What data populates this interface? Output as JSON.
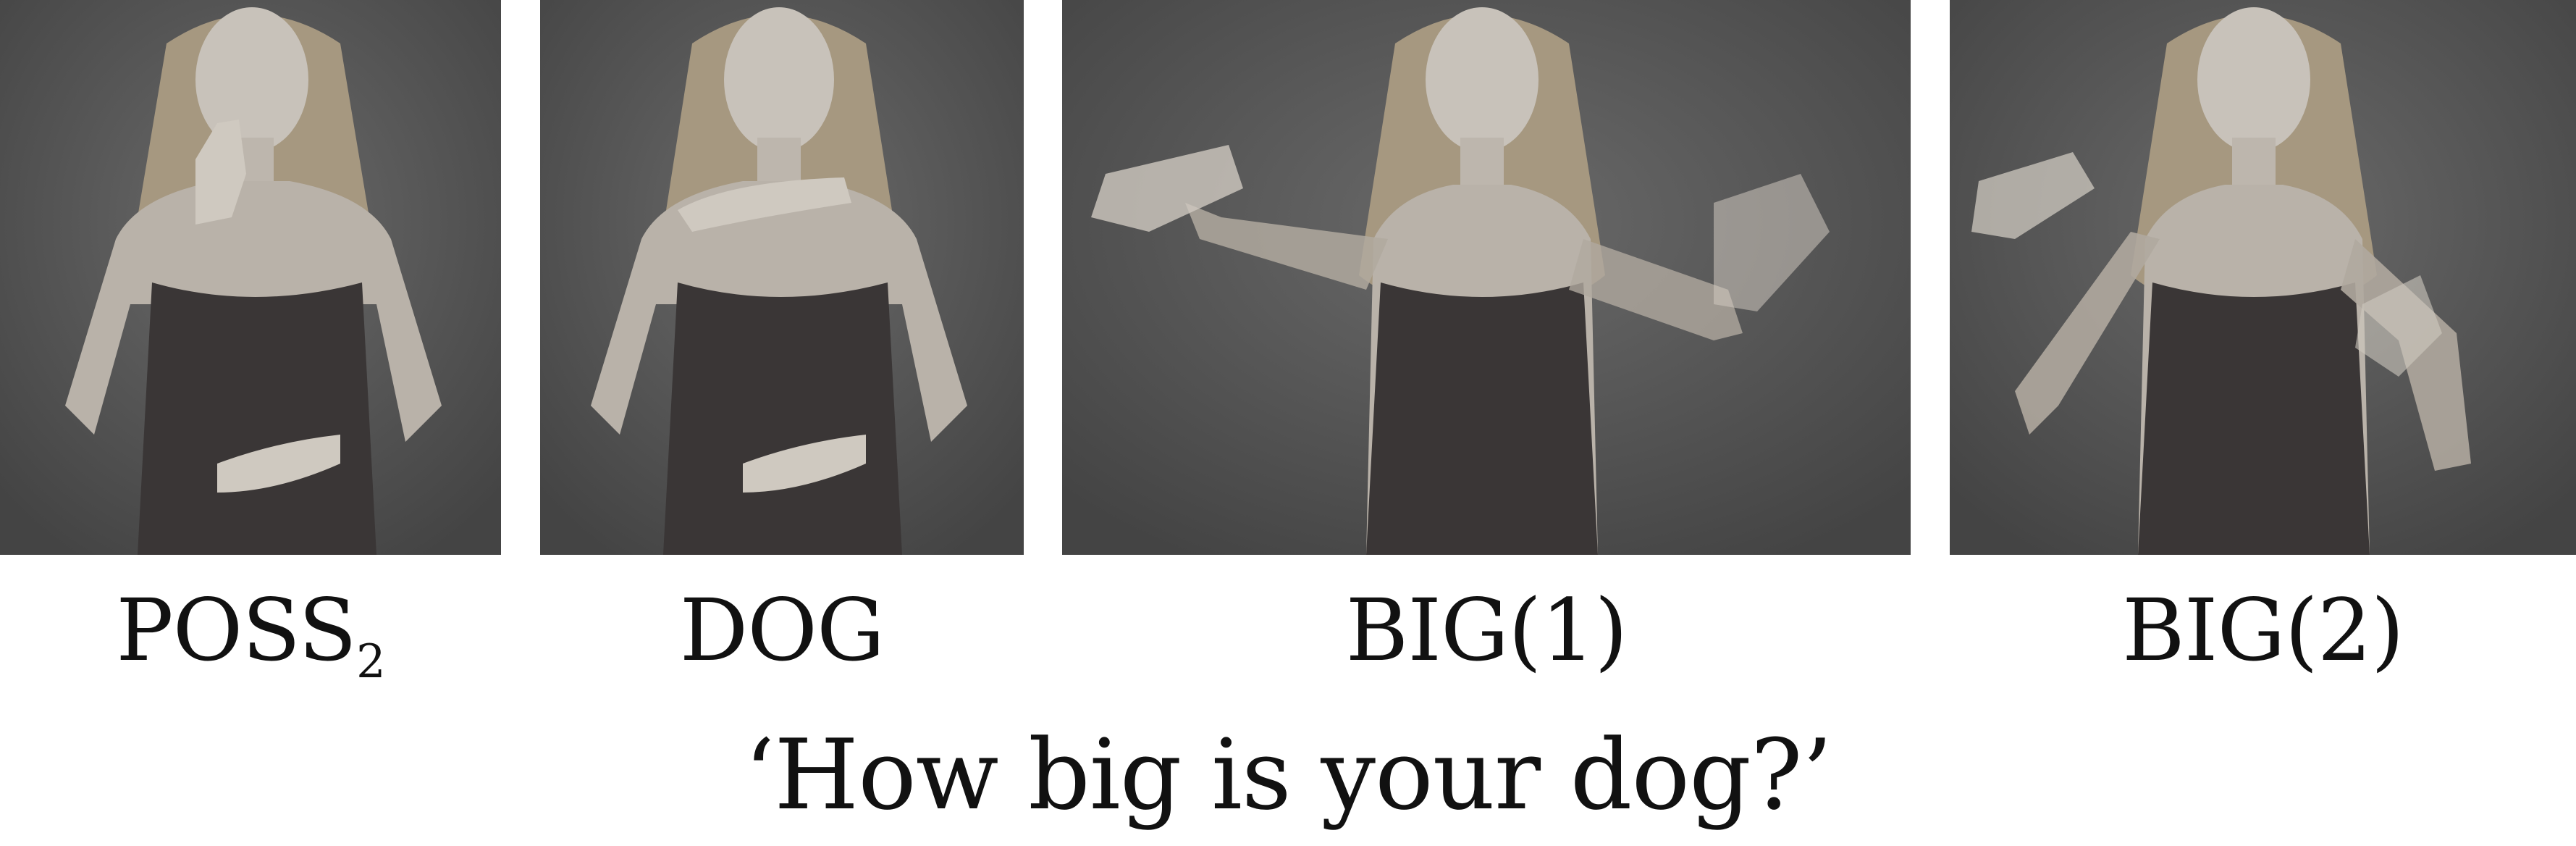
{
  "photos": [
    {
      "gloss": "POSS",
      "subscript": "2"
    },
    {
      "gloss": "DOG",
      "subscript": ""
    },
    {
      "gloss": "BIG(1)",
      "subscript": ""
    },
    {
      "gloss": "BIG(2)",
      "subscript": ""
    }
  ],
  "translation": "‘How big is your dog?’",
  "colors": {
    "background": "#ffffff",
    "photo_backdrop": "#5a5a5a",
    "text": "#111111"
  }
}
